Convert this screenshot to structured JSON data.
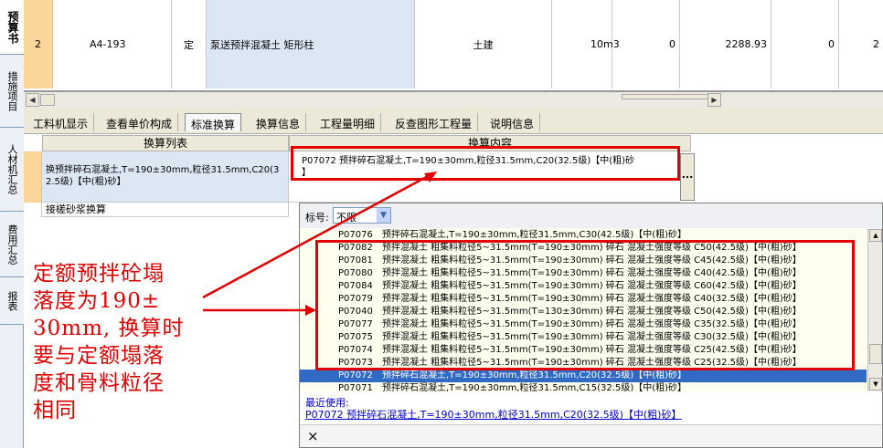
{
  "sidebar": {
    "tabs": [
      {
        "label": "预算书"
      },
      {
        "label": "措施项目"
      },
      {
        "label": "人材机汇总"
      },
      {
        "label": "费用汇总"
      },
      {
        "label": "报表"
      }
    ]
  },
  "top_row": {
    "index": "2",
    "code": "A4-193",
    "type": "定",
    "name": "泵送预拌混凝土 矩形柱",
    "category": "土建",
    "unit": "10m3",
    "qty": "0",
    "price": "2288.93",
    "total": "0",
    "extra": "2"
  },
  "tabs": [
    {
      "label": "工料机显示"
    },
    {
      "label": "查看单价构成"
    },
    {
      "label": "标准换算"
    },
    {
      "label": "换算信息"
    },
    {
      "label": "工程量明细"
    },
    {
      "label": "反查图形工程量"
    },
    {
      "label": "说明信息"
    }
  ],
  "conversion": {
    "list_header": "换算列表",
    "content_header": "换算内容",
    "row1_label": "换预拌碎石混凝土,T=190±30mm,粒径31.5mm,C20(3\n2.5级)【中(粗)砂】",
    "row1_content": "P07072  预拌碎石混凝土,T=190±30mm,粒径31.5mm,C20(32.5级)【中(粗)砂\n】",
    "row2_label": "接槎砂浆换算",
    "browse_button": "..."
  },
  "popup": {
    "filter_label": "标号:",
    "filter_value": "不限",
    "items": [
      {
        "code": "P07076",
        "text": "预拌碎石混凝土,T=190±30mm,粒径31.5mm,C30(42.5级)【中(粗)砂】"
      },
      {
        "code": "P07082",
        "text": "预拌混凝土 粗集料粒径5~31.5mm(T=190±30mm) 碎石 混凝土强度等级 C50(42.5级)【中(粗)砂】"
      },
      {
        "code": "P07081",
        "text": "预拌混凝土 粗集料粒径5~31.5mm(T=190±30mm) 碎石 混凝土强度等级 C45(42.5级)【中(粗)砂】"
      },
      {
        "code": "P07080",
        "text": "预拌混凝土 粗集料粒径5~31.5mm(T=190±30mm) 碎石 混凝土强度等级 C40(42.5级)【中(粗)砂】"
      },
      {
        "code": "P07084",
        "text": "预拌混凝土 粗集料粒径5~31.5mm(T=190±30mm) 碎石 混凝土强度等级 C60(42.5级)【中(粗)砂】"
      },
      {
        "code": "P07079",
        "text": "预拌混凝土 粗集料粒径5~31.5mm(T=190±30mm) 碎石 混凝土强度等级 C40(32.5级)【中(粗)砂】"
      },
      {
        "code": "P07040",
        "text": "预拌混凝土 粗集料粒径5~31.5mm(T=130±30mm) 碎石 混凝土强度等级 C50(42.5级)【中(粗)砂】"
      },
      {
        "code": "P07077",
        "text": "预拌混凝土 粗集料粒径5~31.5mm(T=190±30mm) 碎石 混凝土强度等级 C35(32.5级)【中(粗)砂】"
      },
      {
        "code": "P07075",
        "text": "预拌混凝土 粗集料粒径5~31.5mm(T=190±30mm) 碎石 混凝土强度等级 C30(32.5级)【中(粗)砂】"
      },
      {
        "code": "P07074",
        "text": "预拌混凝土 粗集料粒径5~31.5mm(T=190±30mm) 碎石 混凝土强度等级 C25(42.5级)【中(粗)砂】"
      },
      {
        "code": "P07073",
        "text": "预拌混凝土 粗集料粒径5~31.5mm(T=190±30mm) 碎石 混凝土强度等级 C25(32.5级)【中(粗)砂】"
      },
      {
        "code": "P07072",
        "text": "预拌碎石混凝土,T=190±30mm,粒径31.5mm,C20(32.5级)【中(粗)砂】"
      },
      {
        "code": "P07071",
        "text": "预拌碎石混凝土,T=190±30mm,粒径31.5mm,C15(32.5级)【中(粗)砂】"
      }
    ],
    "recent_label": "最近使用:",
    "recent_item": "P07072 预拌碎石混凝土,T=190±30mm,粒径31.5mm,C20(32.5级)【中(粗)砂】",
    "close_label": "×"
  },
  "annotation": {
    "text": "定额预拌砼塌\n落度为190±\n30mm, 换算时\n要与定额塌落\n度和骨料粒径\n相同"
  },
  "colors": {
    "accent_red": "#e00000",
    "selection": "#316ac5",
    "row_header": "#fbd59a"
  }
}
